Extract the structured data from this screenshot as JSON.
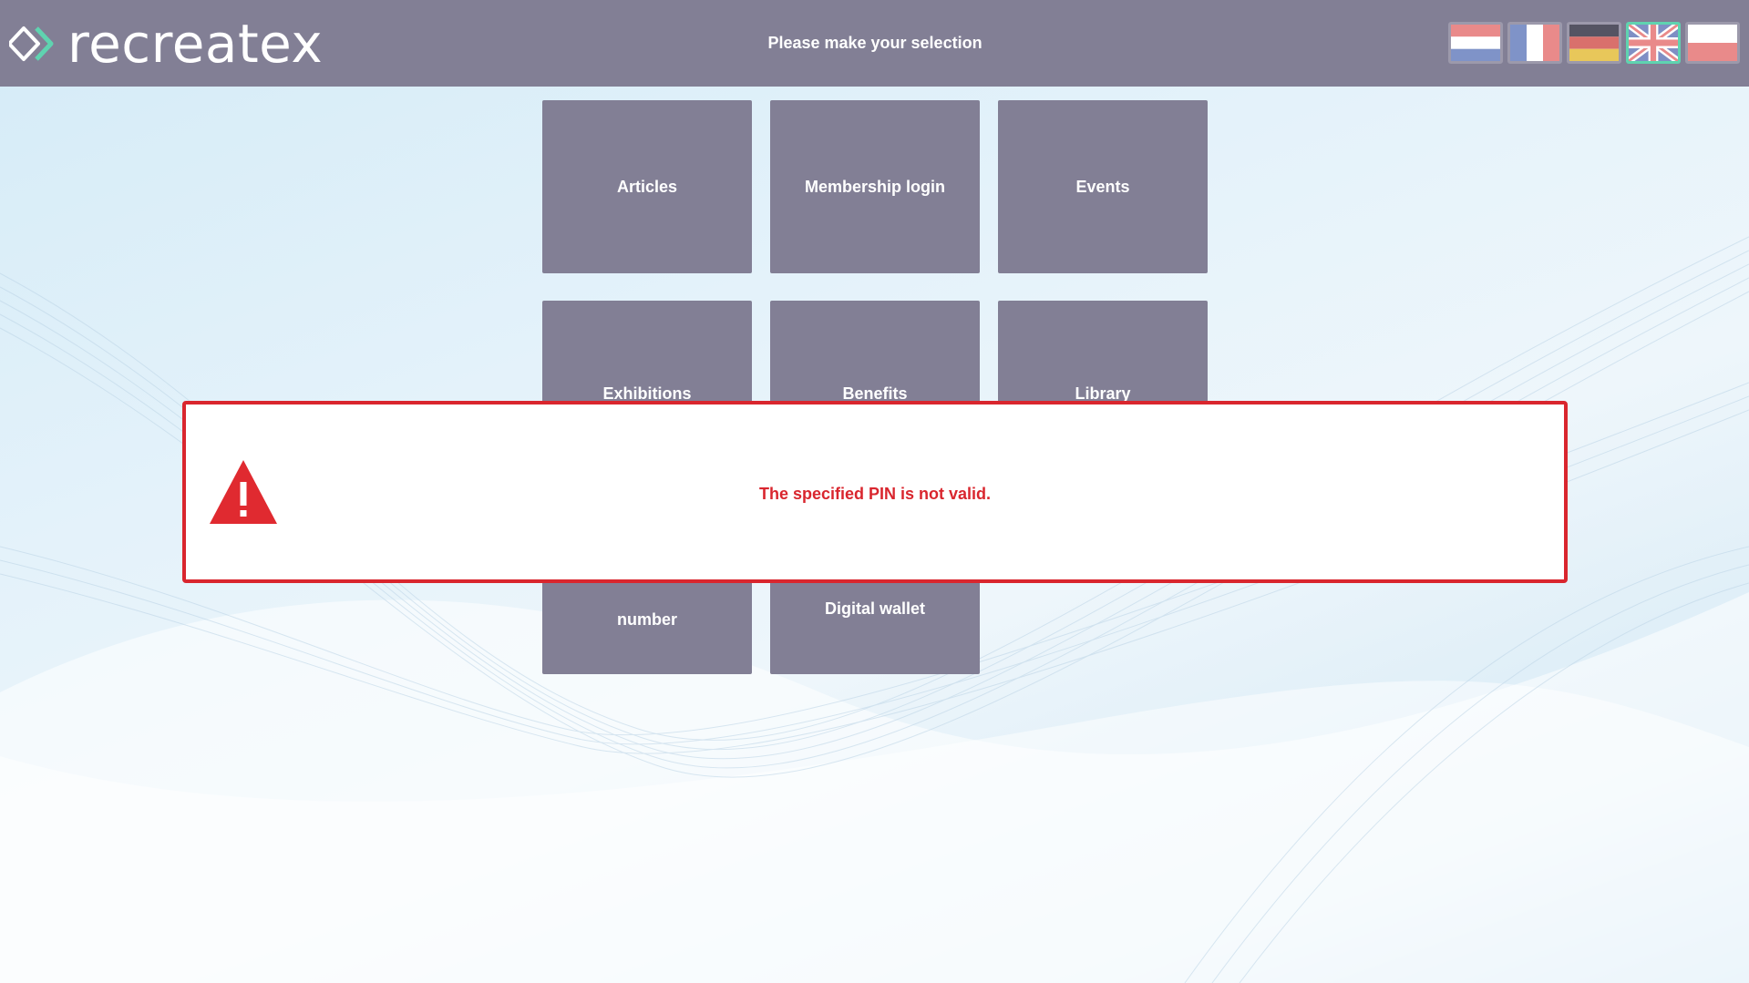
{
  "header": {
    "logo_text": "recreatex",
    "title": "Please make your selection"
  },
  "languages": [
    {
      "code": "nl",
      "icon": "flag-netherlands-icon",
      "selected": false
    },
    {
      "code": "fr",
      "icon": "flag-france-icon",
      "selected": false
    },
    {
      "code": "de",
      "icon": "flag-germany-icon",
      "selected": false
    },
    {
      "code": "en",
      "icon": "flag-uk-icon",
      "selected": true
    },
    {
      "code": "pl",
      "icon": "flag-poland-icon",
      "selected": false
    }
  ],
  "tiles": [
    {
      "label": "Articles"
    },
    {
      "label": "Membership login"
    },
    {
      "label": "Events"
    },
    {
      "label": "Exhibitions"
    },
    {
      "label": "Benefits"
    },
    {
      "label": "Library"
    },
    {
      "label": "number"
    },
    {
      "label": "Digital wallet"
    }
  ],
  "alert": {
    "icon": "warning-triangle-icon",
    "message": "The specified PIN is not valid."
  },
  "colors": {
    "header_bg": "#827f95",
    "tile_bg": "#827f95",
    "alert_red": "#d9262e",
    "logo_accent": "#5fd3b0"
  }
}
